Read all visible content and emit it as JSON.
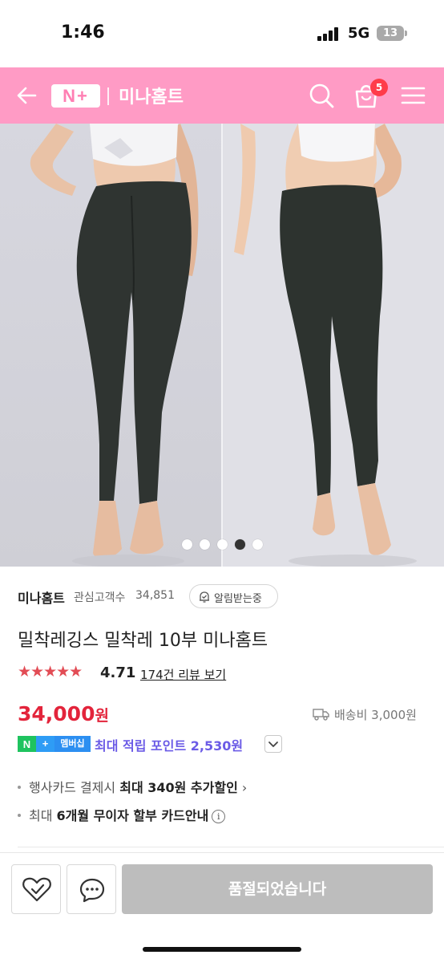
{
  "status_bar": {
    "time": "1:46",
    "network": "5G",
    "battery": "13"
  },
  "header": {
    "back_icon": "back-arrow-icon",
    "logo_text": "N+",
    "shop_name": "미나홈트",
    "search_icon": "search-icon",
    "cart_icon": "shopping-bag-icon",
    "cart_count": "5",
    "menu_icon": "hamburger-menu-icon",
    "brand_color": "#ff9bc5"
  },
  "gallery": {
    "image_icon": "leggings-product-photo",
    "page_count": 5,
    "active_index": 3
  },
  "store": {
    "name": "미나홈트",
    "follower_label": "관심고객수",
    "follower_count": "34,851",
    "alarm_label": "알림받는중"
  },
  "product": {
    "title": "밀착레깅스 밀착레 10부 미나홈트",
    "stars": "★★★★★",
    "rating": "4.71",
    "review_link": "174건 리뷰 보기",
    "price": "34,000",
    "price_unit": "원",
    "price_color": "#e3243b",
    "shipping": "배송비 3,000원"
  },
  "membership": {
    "badge_n": "N",
    "badge_plus": "+",
    "badge_label": "멤버십",
    "point_text": "최대 적립 포인트 2,530원"
  },
  "benefits": {
    "card_prefix": "행사카드 결제시 ",
    "card_strong": "최대 340원 추가할인",
    "card_suffix": " ›",
    "installment_prefix": "최대 ",
    "installment_strong": "6개월 무이자 할부 카드안내",
    "info_icon": "i"
  },
  "bottom_bar": {
    "wish_icon": "heart-check-icon",
    "talk_icon": "chat-bubble-icon",
    "soldout_label": "품절되었습니다"
  }
}
